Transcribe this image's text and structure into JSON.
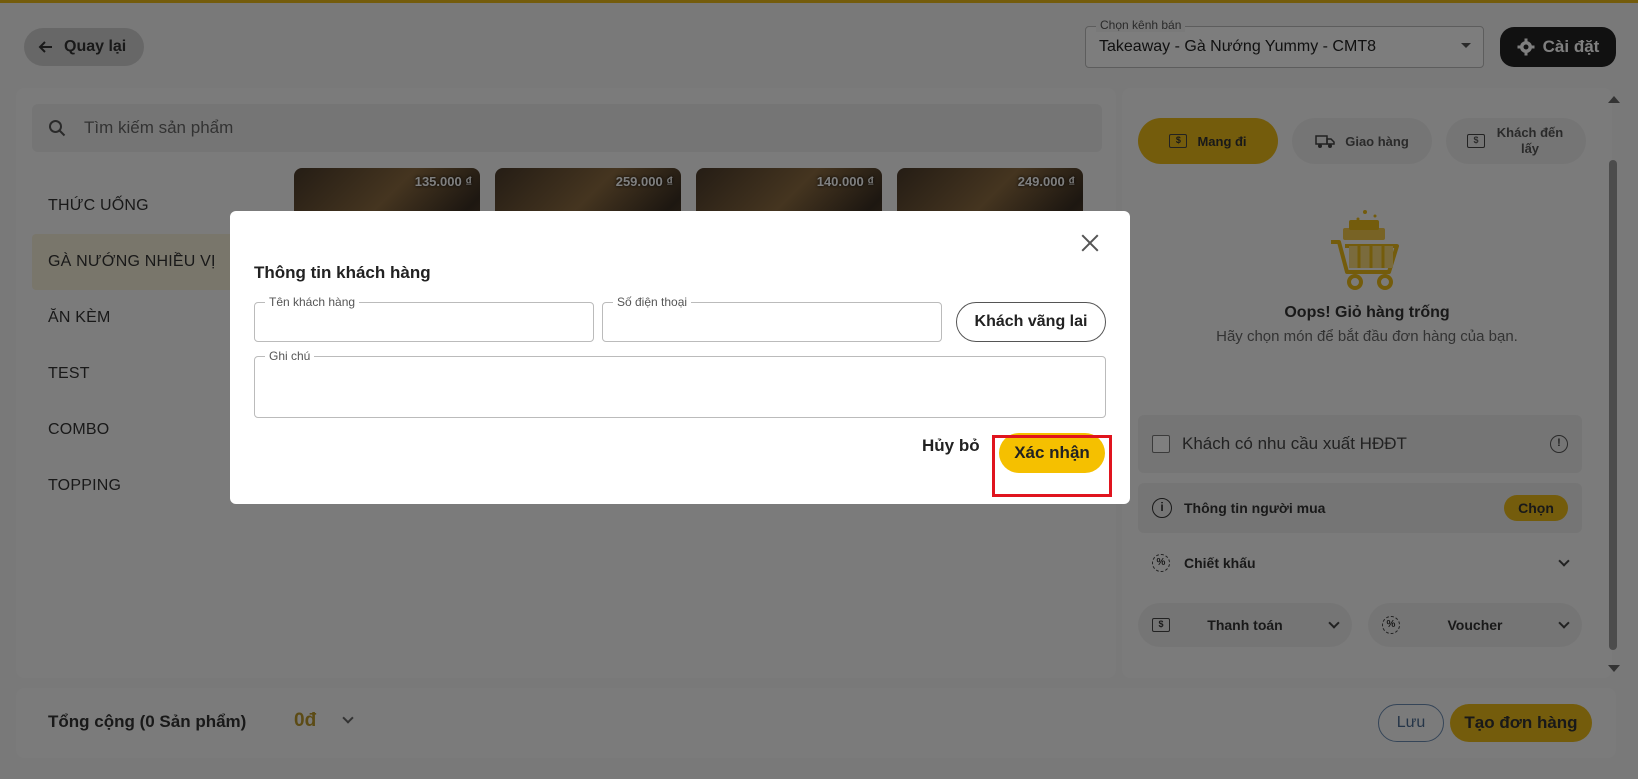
{
  "header": {
    "back_label": "Quay lại",
    "channel_legend": "Chọn kênh bán",
    "channel_value": "Takeaway - Gà Nướng Yummy - CMT8",
    "settings_label": "Cài đặt"
  },
  "search": {
    "placeholder": "Tìm kiếm sản phẩm"
  },
  "categories": [
    "THỨC UỐNG",
    "GÀ NƯỚNG NHIỀU VỊ",
    "ĂN KÈM",
    "TEST",
    "COMBO",
    "TOPPING"
  ],
  "active_category": "GÀ NƯỚNG NHIỀU VỊ",
  "products": [
    {
      "price": "135.000 ₫"
    },
    {
      "price": "259.000 ₫"
    },
    {
      "price": "140.000 ₫"
    },
    {
      "price": "249.000 ₫"
    }
  ],
  "order_modes": [
    {
      "label": "Mang đi",
      "active": true
    },
    {
      "label": "Giao hàng",
      "active": false
    },
    {
      "label": "Khách đến lấy",
      "active": false
    }
  ],
  "cart": {
    "empty_title": "Oops! Giỏ hàng trống",
    "empty_sub": "Hãy chọn món để bắt đầu đơn hàng của bạn."
  },
  "einvoice_label": "Khách có nhu cầu xuất HĐĐT",
  "buyer": {
    "label": "Thông tin người mua",
    "choose": "Chọn"
  },
  "discount_label": "Chiết khấu",
  "payment_label": "Thanh toán",
  "voucher_label": "Voucher",
  "footer": {
    "total_label": "Tổng cộng (0 Sản phẩm)",
    "total_value": "0đ",
    "save_label": "Lưu",
    "create_label": "Tạo đơn hàng"
  },
  "modal": {
    "title": "Thông tin khách hàng",
    "name_legend": "Tên khách hàng",
    "name_value": "",
    "phone_legend": "Số điện thoại",
    "phone_value": "",
    "guest_label": "Khách vãng lai",
    "note_legend": "Ghi chú",
    "note_value": "",
    "cancel_label": "Hủy bỏ",
    "confirm_label": "Xác nhận"
  },
  "colors": {
    "accent": "#e8b818",
    "confirm": "#f5c000",
    "highlight": "#e0141e"
  }
}
